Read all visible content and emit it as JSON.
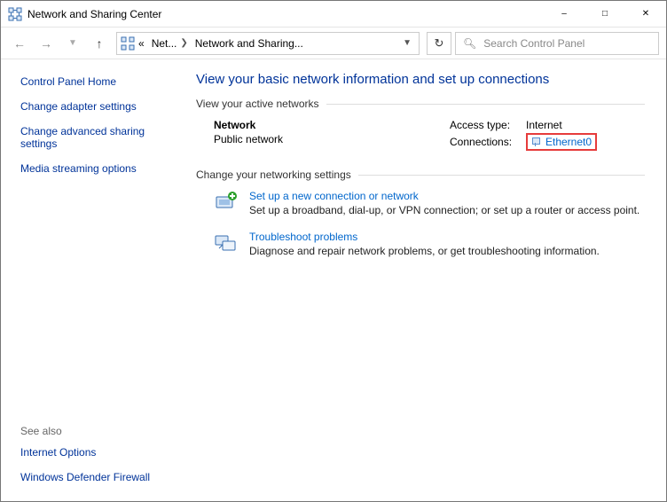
{
  "window": {
    "title": "Network and Sharing Center"
  },
  "breadcrumb": {
    "root_icon": "control-panel",
    "chev": "«",
    "seg1": "Net...",
    "seg2": "Network and Sharing..."
  },
  "search": {
    "placeholder": "Search Control Panel"
  },
  "sidebar": {
    "home": "Control Panel Home",
    "links": [
      "Change adapter settings",
      "Change advanced sharing settings",
      "Media streaming options"
    ],
    "see_also_label": "See also",
    "see_also": [
      "Internet Options",
      "Windows Defender Firewall"
    ]
  },
  "main": {
    "heading": "View your basic network information and set up connections",
    "active_heading": "View your active networks",
    "network": {
      "name": "Network",
      "type": "Public network"
    },
    "access": {
      "access_label": "Access type:",
      "access_value": "Internet",
      "conn_label": "Connections:",
      "conn_value": "Ethernet0"
    },
    "settings_heading": "Change your networking settings",
    "opts": [
      {
        "title": "Set up a new connection or network",
        "desc": "Set up a broadband, dial-up, or VPN connection; or set up a router or access point."
      },
      {
        "title": "Troubleshoot problems",
        "desc": "Diagnose and repair network problems, or get troubleshooting information."
      }
    ]
  }
}
